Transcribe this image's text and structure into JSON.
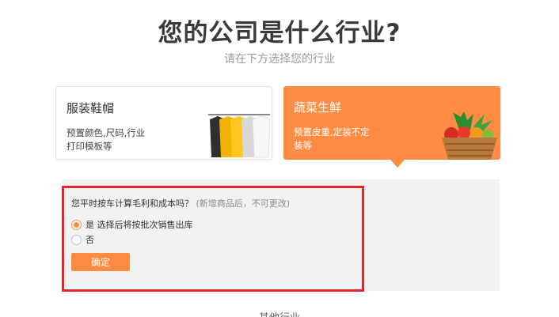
{
  "header": {
    "title": "您的公司是什么行业?",
    "subtitle": "请在下方选择您的行业"
  },
  "industries": [
    {
      "title": "服装鞋帽",
      "desc_line1": "预置颜色,尺码,行业",
      "desc_line2": "打印模板等",
      "icon": "clothes-rack-icon",
      "selected": false
    },
    {
      "title": "蔬菜生鲜",
      "desc_line1": "预置皮重,定装不定",
      "desc_line2": "装等",
      "icon": "vegetable-basket-icon",
      "selected": true
    }
  ],
  "settings": {
    "question": "您平时按车计算毛利和成本吗？",
    "question_hint": "(新增商品后，不可更改)",
    "options": [
      {
        "label": "是 选择后将按批次销售出库",
        "checked": true
      },
      {
        "label": "否",
        "checked": false
      }
    ],
    "confirm_label": "确定"
  },
  "footer": {
    "other_industry": "其他行业"
  },
  "colors": {
    "accent": "#ff8c42",
    "highlight": "#e5242b",
    "panel": "#f2f2f2"
  }
}
